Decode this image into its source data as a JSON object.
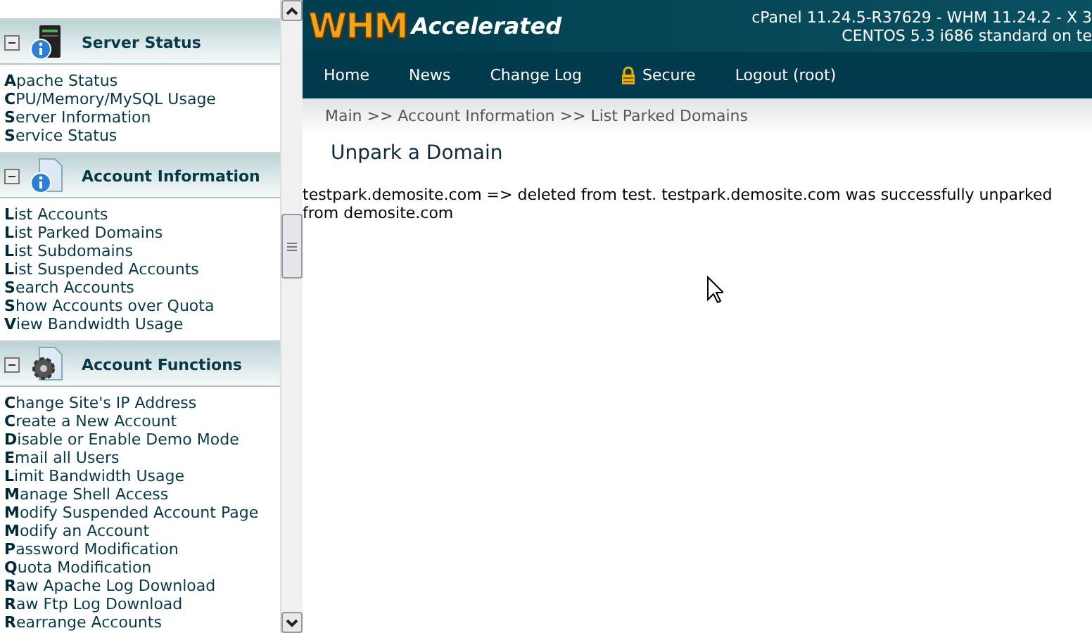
{
  "sidebar": {
    "sections": [
      {
        "title": "Server Status",
        "kind": "server",
        "expanded": true,
        "items": [
          "**A**pache Status",
          "**C**PU/Memory/MySQL Usage",
          "**S**erver Information",
          "**S**ervice Status"
        ]
      },
      {
        "title": "Account Information",
        "kind": "document",
        "expanded": true,
        "items": [
          "**L**ist Accounts",
          "**L**ist Parked Domains",
          "**L**ist Subdomains",
          "**L**ist Suspended Accounts",
          "**S**earch Accounts",
          "**S**how Accounts over Quota",
          "**V**iew Bandwidth Usage"
        ]
      },
      {
        "title": "Account Functions",
        "kind": "gear",
        "expanded": true,
        "items": [
          "**C**hange Site's IP Address",
          "**C**reate a New Account",
          "**D**isable or Enable Demo Mode",
          "**E**mail all Users",
          "**L**imit Bandwidth Usage",
          "**M**anage Shell Access",
          "**M**odify Suspended Account Page",
          "**M**odify an Account",
          "**P**assword Modification",
          "**Q**uota Modification",
          "**R**aw Apache Log Download",
          "**R**aw Ftp Log Download",
          "**R**earrange Accounts"
        ]
      }
    ]
  },
  "header": {
    "logo_main": "WHM",
    "logo_sub": "Accelerated",
    "version_line": "cPanel 11.24.5-R37629 - WHM 11.24.2 - X 3",
    "os_line": "CENTOS 5.3 i686 standard on te"
  },
  "nav": [
    {
      "label": "Home",
      "kind": "link"
    },
    {
      "label": "News",
      "kind": "link"
    },
    {
      "label": "Change Log",
      "kind": "link"
    },
    {
      "label": "Secure",
      "kind": "lock"
    },
    {
      "label": "Logout (root)",
      "kind": "link"
    }
  ],
  "breadcrumb": "Main >> Account Information >> List Parked Domains",
  "page_title": "Unpark a Domain",
  "message": "testpark.demosite.com => deleted from test. testpark.demosite.com was successfully unparked from demosite.com"
}
